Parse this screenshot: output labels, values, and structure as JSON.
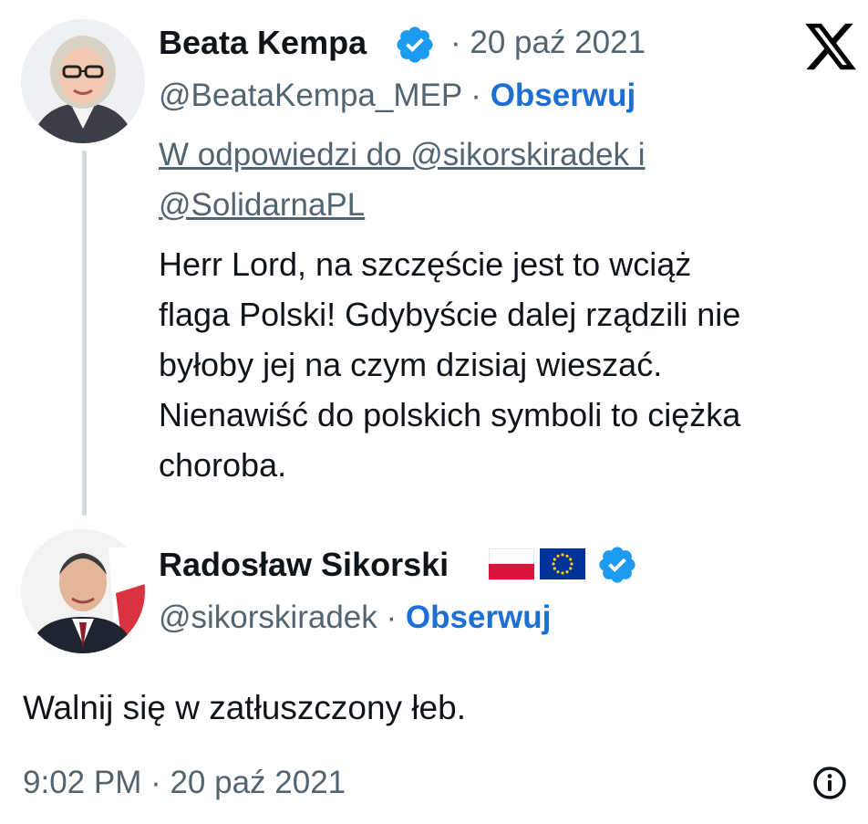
{
  "tweet1": {
    "author_name": "Beata Kempa",
    "date": "· 20 paź 2021",
    "handle": "@BeataKempa_MEP",
    "separator": " · ",
    "follow_label": "Obserwuj",
    "reply_to_lines": [
      "W odpowiedzi do @sikorskiradek i",
      "@SolidarnaPL"
    ],
    "text_lines": [
      "Herr Lord, na szczęście jest to wciąż",
      "flaga Polski! Gdybyście dalej rządzili nie",
      "byłoby jej na czym dzisiaj wieszać.",
      "Nienawiść do polskich symboli to ciężka",
      "choroba."
    ]
  },
  "tweet2": {
    "author_name": "Radosław Sikorski",
    "handle": "@sikorskiradek",
    "separator": " · ",
    "follow_label": "Obserwuj",
    "text": "Walnij się w zatłuszczony łeb.",
    "timestamp": "9:02 PM · 20 paź 2021"
  },
  "icons": {
    "logo": "x-logo-icon",
    "verified": "verified-badge-icon",
    "info": "info-icon",
    "flags": [
      "poland-flag-icon",
      "eu-flag-icon"
    ]
  },
  "colors": {
    "text": "#0f1419",
    "secondary": "#536471",
    "follow": "#1d6fd6",
    "verified": "#1d9bf0",
    "thread_line": "#cfd9de"
  }
}
